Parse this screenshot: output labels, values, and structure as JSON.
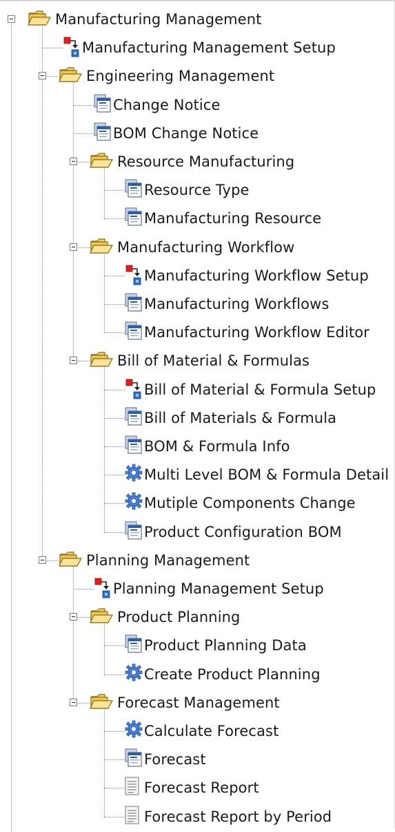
{
  "tree": {
    "items": [
      {
        "label": "Manufacturing Management",
        "type": "folder",
        "level": 0,
        "expanded": true
      },
      {
        "label": "Manufacturing Management Setup",
        "type": "setup",
        "level": 1
      },
      {
        "label": "Engineering Management",
        "type": "folder",
        "level": 1,
        "expanded": true
      },
      {
        "label": "Change Notice",
        "type": "window",
        "level": 2
      },
      {
        "label": "BOM Change Notice",
        "type": "window",
        "level": 2
      },
      {
        "label": "Resource Manufacturing",
        "type": "folder",
        "level": 2,
        "expanded": true
      },
      {
        "label": "Resource Type",
        "type": "window",
        "level": 3
      },
      {
        "label": "Manufacturing Resource",
        "type": "window",
        "level": 3
      },
      {
        "label": "Manufacturing Workflow",
        "type": "folder",
        "level": 2,
        "expanded": true
      },
      {
        "label": "Manufacturing Workflow Setup",
        "type": "setup",
        "level": 3
      },
      {
        "label": "Manufacturing Workflows",
        "type": "window",
        "level": 3
      },
      {
        "label": "Manufacturing Workflow Editor",
        "type": "window",
        "level": 3
      },
      {
        "label": "Bill of Material & Formulas",
        "type": "folder",
        "level": 2,
        "expanded": true
      },
      {
        "label": "Bill of Material & Formula Setup",
        "type": "setup",
        "level": 3
      },
      {
        "label": "Bill of Materials & Formula",
        "type": "window",
        "level": 3
      },
      {
        "label": "BOM & Formula Info",
        "type": "window",
        "level": 3
      },
      {
        "label": "Multi Level BOM & Formula Detail",
        "type": "process",
        "level": 3
      },
      {
        "label": "Mutiple Components Change",
        "type": "process",
        "level": 3
      },
      {
        "label": "Product Configuration BOM",
        "type": "window",
        "level": 3
      },
      {
        "label": "Planning Management",
        "type": "folder",
        "level": 1,
        "expanded": true
      },
      {
        "label": "Planning Management Setup",
        "type": "setup",
        "level": 2
      },
      {
        "label": "Product Planning",
        "type": "folder",
        "level": 2,
        "expanded": true
      },
      {
        "label": "Product Planning Data",
        "type": "window",
        "level": 3
      },
      {
        "label": "Create Product Planning",
        "type": "process",
        "level": 3
      },
      {
        "label": "Forecast Management",
        "type": "folder",
        "level": 2,
        "expanded": true
      },
      {
        "label": "Calculate Forecast",
        "type": "process",
        "level": 3
      },
      {
        "label": "Forecast",
        "type": "window",
        "level": 3
      },
      {
        "label": "Forecast Report",
        "type": "report",
        "level": 3
      },
      {
        "label": "Forecast Report by Period",
        "type": "report",
        "level": 3
      }
    ]
  }
}
